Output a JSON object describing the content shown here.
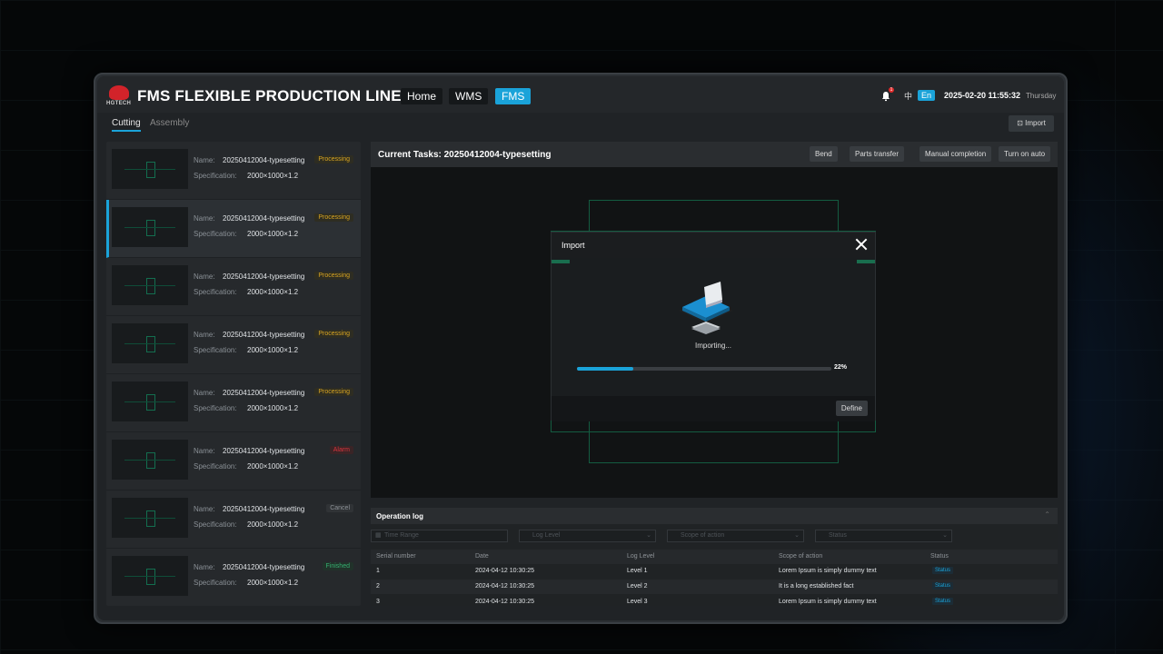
{
  "app": {
    "title": "FMS FLEXIBLE PRODUCTION LINE",
    "logo_text": "HGTECH"
  },
  "nav": [
    {
      "label": "Home"
    },
    {
      "label": "WMS"
    },
    {
      "label": "FMS",
      "active": true
    }
  ],
  "header": {
    "notifications": "1",
    "lang_zh": "中",
    "lang_en": "En",
    "datetime": "2025-02-20 11:55:32",
    "weekday": "Thursday"
  },
  "tabs": [
    {
      "label": "Cutting",
      "active": true
    },
    {
      "label": "Assembly"
    }
  ],
  "toolbar": {
    "import_label": "Import"
  },
  "task_list": [
    {
      "name_label": "Name:",
      "name": "20250412004-typesetting",
      "spec_label": "Specification:",
      "spec": "2000×1000×1.2",
      "status": "Processing",
      "kind": "processing"
    },
    {
      "name_label": "Name:",
      "name": "20250412004-typesetting",
      "spec_label": "Specification:",
      "spec": "2000×1000×1.2",
      "status": "Processing",
      "kind": "processing",
      "selected": true
    },
    {
      "name_label": "Name:",
      "name": "20250412004-typesetting",
      "spec_label": "Specification:",
      "spec": "2000×1000×1.2",
      "status": "Processing",
      "kind": "processing"
    },
    {
      "name_label": "Name:",
      "name": "20250412004-typesetting",
      "spec_label": "Specification:",
      "spec": "2000×1000×1.2",
      "status": "Processing",
      "kind": "processing"
    },
    {
      "name_label": "Name:",
      "name": "20250412004-typesetting",
      "spec_label": "Specification:",
      "spec": "2000×1000×1.2",
      "status": "Processing",
      "kind": "processing"
    },
    {
      "name_label": "Name:",
      "name": "20250412004-typesetting",
      "spec_label": "Specification:",
      "spec": "2000×1000×1.2",
      "status": "Alarm",
      "kind": "alarm"
    },
    {
      "name_label": "Name:",
      "name": "20250412004-typesetting",
      "spec_label": "Specification:",
      "spec": "2000×1000×1.2",
      "status": "Cancel",
      "kind": "cancel"
    },
    {
      "name_label": "Name:",
      "name": "20250412004-typesetting",
      "spec_label": "Specification:",
      "spec": "2000×1000×1.2",
      "status": "Finished",
      "kind": "finished"
    }
  ],
  "current_task": {
    "title": "Current Tasks: 20250412004-typesetting",
    "buttons": [
      "Bend",
      "Parts transfer",
      "Manual completion",
      "Turn on auto"
    ]
  },
  "modal": {
    "title": "Import",
    "status_text": "Importing...",
    "progress": 0.22,
    "progress_label": "22%",
    "define_label": "Define"
  },
  "oplog": {
    "title": "Operation log",
    "filters": [
      "Time Range",
      "Log Level",
      "Scope of action",
      "Status"
    ],
    "columns": [
      "Serial number",
      "Date",
      "Log Level",
      "Scope of action",
      "Status"
    ],
    "rows": [
      [
        "1",
        "2024-04-12 10:30:25",
        "Level 1",
        "Lorem Ipsum is simply dummy text",
        "Status"
      ],
      [
        "2",
        "2024-04-12 10:30:25",
        "Level 2",
        "It is a long established fact",
        "Status"
      ],
      [
        "3",
        "2024-04-12 10:30:25",
        "Level 3",
        "Lorem Ipsum is simply dummy text",
        "Status"
      ]
    ]
  },
  "colors": {
    "accent": "#1aa3d9",
    "processing": "#d9a521",
    "alarm": "#d7343d",
    "finished": "#35b070",
    "outline": "#1f8e65"
  }
}
